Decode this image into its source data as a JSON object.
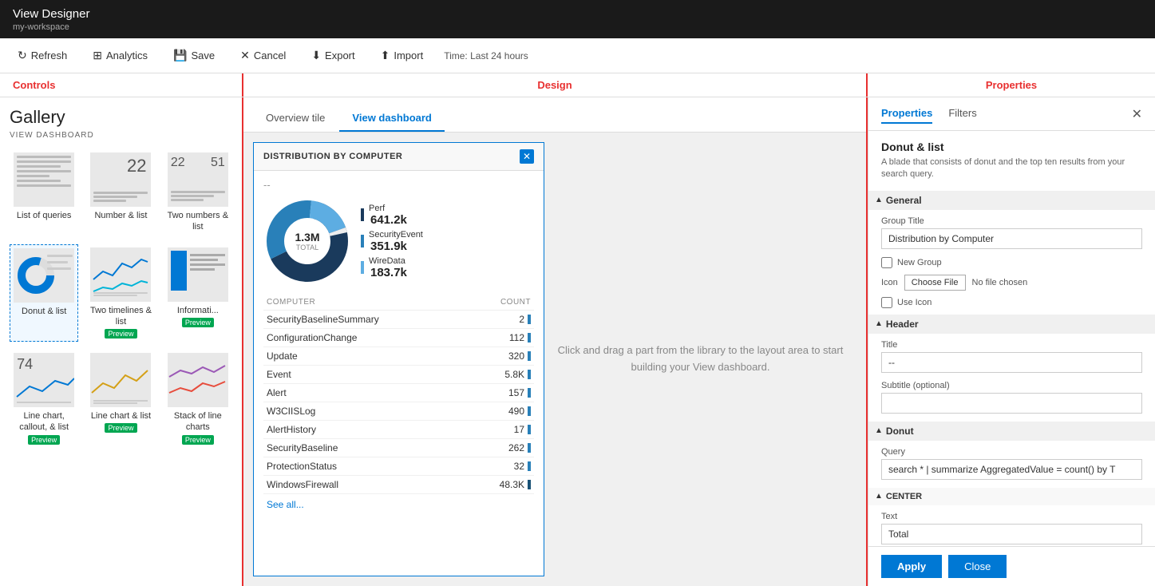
{
  "titleBar": {
    "appTitle": "View Designer",
    "workspace": "my-workspace"
  },
  "toolbar": {
    "refreshLabel": "Refresh",
    "analyticsLabel": "Analytics",
    "saveLabel": "Save",
    "cancelLabel": "Cancel",
    "exportLabel": "Export",
    "importLabel": "Import",
    "timeInfo": "Time: Last 24 hours"
  },
  "sectionLabels": {
    "controls": "Controls",
    "design": "Design",
    "properties": "Properties"
  },
  "gallery": {
    "title": "Gallery",
    "subtitle": "VIEW DASHBOARD",
    "items": [
      {
        "id": "list-queries",
        "label": "List of queries",
        "type": "lines",
        "active": false,
        "preview": false
      },
      {
        "id": "number-list",
        "label": "Number & list",
        "type": "number",
        "number": "22",
        "active": false,
        "preview": false
      },
      {
        "id": "two-numbers",
        "label": "Two numbers & list",
        "type": "two-numbers",
        "n1": "22",
        "n2": "51",
        "active": false,
        "preview": false
      },
      {
        "id": "donut-list",
        "label": "Donut & list",
        "type": "donut",
        "active": true,
        "preview": false
      },
      {
        "id": "two-timelines",
        "label": "Two timelines & list",
        "type": "timelines",
        "active": false,
        "preview": true
      },
      {
        "id": "information",
        "label": "Informati... Preview",
        "type": "info",
        "active": false,
        "preview": true
      },
      {
        "id": "line-callout",
        "label": "Line chart, callout, & list",
        "type": "line-callout",
        "number": "74",
        "active": false,
        "preview": true
      },
      {
        "id": "line-list",
        "label": "Line chart & list",
        "type": "line-list",
        "active": false,
        "preview": true
      },
      {
        "id": "stack-charts",
        "label": "Stack of line charts",
        "type": "stack",
        "active": false,
        "preview": true
      }
    ]
  },
  "tabs": {
    "overviewTile": "Overview tile",
    "viewDashboard": "View dashboard",
    "activeTab": "viewDashboard"
  },
  "widget": {
    "title": "DISTRIBUTION BY COMPUTER",
    "dash": "--",
    "donut": {
      "total": "1.3M",
      "totalLabel": "TOTAL"
    },
    "legend": [
      {
        "label": "Perf",
        "value": "641.2k",
        "color": "#1a5276"
      },
      {
        "label": "SecurityEvent",
        "value": "351.9k",
        "color": "#2980b9"
      },
      {
        "label": "WireData",
        "value": "183.7k",
        "color": "#5dade2"
      }
    ],
    "tableHeaders": [
      "COMPUTER",
      "COUNT"
    ],
    "tableRows": [
      {
        "computer": "SecurityBaselineSummary",
        "count": "2",
        "barColor": "#2980b9"
      },
      {
        "computer": "ConfigurationChange",
        "count": "112",
        "barColor": "#2980b9"
      },
      {
        "computer": "Update",
        "count": "320",
        "barColor": "#2980b9"
      },
      {
        "computer": "Event",
        "count": "5.8K",
        "barColor": "#2980b9"
      },
      {
        "computer": "Alert",
        "count": "157",
        "barColor": "#2980b9"
      },
      {
        "computer": "W3CIISLog",
        "count": "490",
        "barColor": "#2980b9"
      },
      {
        "computer": "AlertHistory",
        "count": "17",
        "barColor": "#2980b9"
      },
      {
        "computer": "SecurityBaseline",
        "count": "262",
        "barColor": "#2980b9"
      },
      {
        "computer": "ProtectionStatus",
        "count": "32",
        "barColor": "#2980b9"
      },
      {
        "computer": "WindowsFirewall",
        "count": "48.3K",
        "barColor": "#1a5276"
      }
    ],
    "seeAll": "See all..."
  },
  "dropZone": {
    "message": "Click and drag a part from the library to the layout area to start building your View dashboard."
  },
  "propertiesPanel": {
    "tabs": [
      "Properties",
      "Filters"
    ],
    "activeTab": "Properties",
    "sectionTitle": "Donut & list",
    "description": "A blade that consists of donut and the top ten results from your search query.",
    "groups": {
      "general": {
        "label": "General",
        "groupTitle": {
          "label": "Group Title",
          "value": "Distribution by Computer"
        },
        "newGroup": {
          "label": "New Group",
          "checked": false
        },
        "icon": {
          "label": "Icon",
          "buttonLabel": "Choose File",
          "fileText": "No file chosen"
        },
        "useIcon": {
          "label": "Use Icon",
          "checked": false
        }
      },
      "header": {
        "label": "Header",
        "title": {
          "label": "Title",
          "value": "--"
        },
        "subtitle": {
          "label": "Subtitle (optional)",
          "value": ""
        }
      },
      "donut": {
        "label": "Donut",
        "query": {
          "label": "Query",
          "value": "search * | summarize AggregatedValue = count() by T"
        },
        "center": {
          "label": "CENTER",
          "text": {
            "label": "Text",
            "value": "Total"
          }
        }
      }
    },
    "footer": {
      "applyLabel": "Apply",
      "closeLabel": "Close"
    }
  }
}
